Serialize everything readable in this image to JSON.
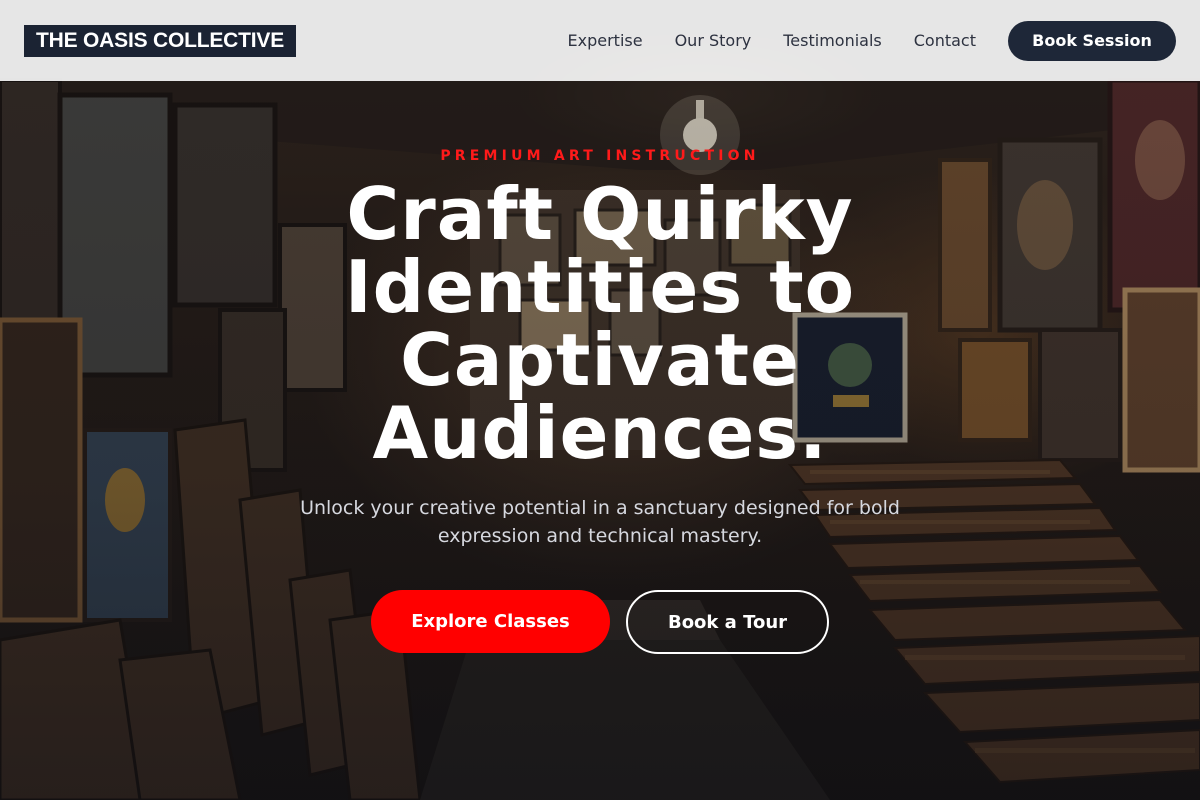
{
  "brand": {
    "name": "THE OASIS COLLECTIVE"
  },
  "nav": {
    "links": [
      {
        "label": "Expertise"
      },
      {
        "label": "Our Story"
      },
      {
        "label": "Testimonials"
      },
      {
        "label": "Contact"
      }
    ],
    "cta_label": "Book Session"
  },
  "hero": {
    "eyebrow": "PREMIUM ART INSTRUCTION",
    "headline": "Craft Quirky Identities to Captivate Audiences.",
    "subtitle": "Unlock your creative potential in a sanctuary designed for bold expression and technical mastery.",
    "primary_button": "Explore Classes",
    "secondary_button": "Book a Tour"
  },
  "colors": {
    "accent": "#ff0000",
    "navy": "#1e2738",
    "nav_background": "#eeeeee"
  }
}
